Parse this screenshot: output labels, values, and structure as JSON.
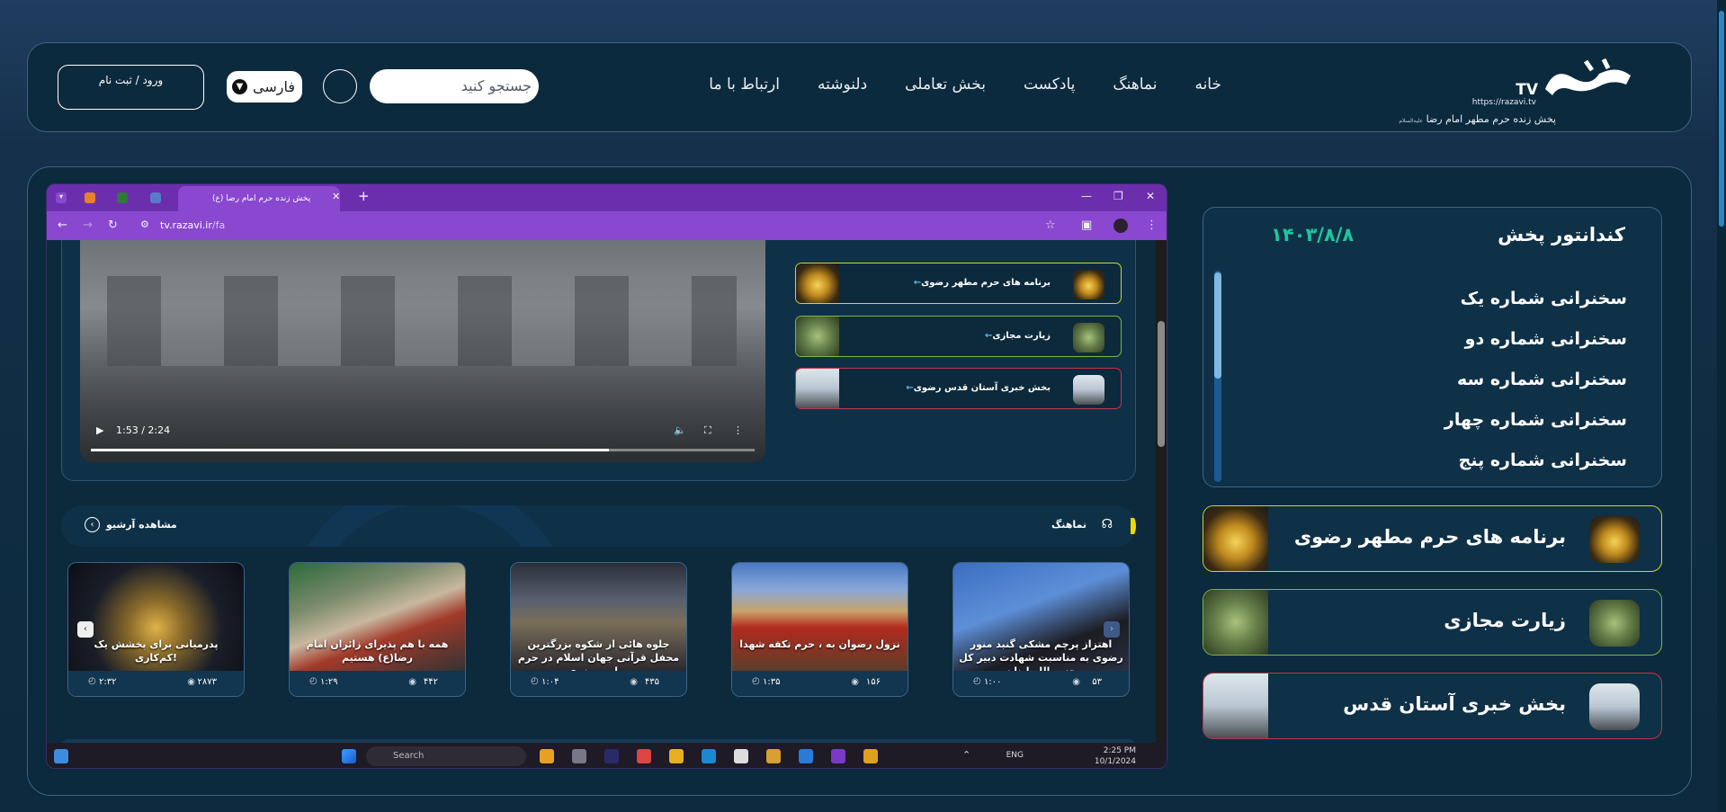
{
  "header": {
    "logo": {
      "tv": "TV",
      "url": "https://razavi.tv",
      "tagline": "پخش زنده حرم مطهر امام رضا",
      "tagline_small": "علیه‌السلام"
    },
    "nav": [
      "خانه",
      "نماهنگ",
      "پادکست",
      "بخش تعاملی",
      "دلنوشته",
      "ارتباط با ما"
    ],
    "search_placeholder": "جستجو کنید",
    "language": "فارسی",
    "login_label": "ورود / ثبت نام"
  },
  "schedule": {
    "title": "کندانتور پخش",
    "date": "۱۴۰۳/۸/۸",
    "items": [
      "سخنرانی شماره یک",
      "سخنرانی شماره دو",
      "سخنرانی شماره سه",
      "سخنرانی شماره چهار",
      "سخنرانی شماره پنج"
    ]
  },
  "channels": [
    {
      "label": "برنامه های حرم مطهر رضوی",
      "accent": "#c8d63a"
    },
    {
      "label": "زیارت مجازی",
      "accent": "#7ab83b"
    },
    {
      "label": "بخش خبری آستان قدس",
      "accent": "#c2354a"
    }
  ],
  "browser": {
    "tab_title": "پخش زنده حرم امام رضا (ع)",
    "url_host": "tv.razavi.ir",
    "url_path": "/fa",
    "video_time": "1:53 / 2:24",
    "video_progress": 0.78,
    "mini_channels": [
      {
        "label": "برنامه های حرم مطهر رضوی",
        "accent": "#c8d63a"
      },
      {
        "label": "زیارت مجازی",
        "accent": "#7ab83b"
      },
      {
        "label": "بخش خبری آستان قدس رضوی",
        "accent": "#c2354a"
      }
    ],
    "section": {
      "title": "نماهنگ",
      "archive": "مشاهده آرشیو"
    },
    "videos": [
      {
        "caption": "اهتزاز پرچم مشکی گنبد منور رضوی به مناسبت شهادت دبیر کل حزب الله لبنان",
        "views": "۵۳",
        "duration": "۱:۰۰"
      },
      {
        "caption": "نزول رضوان به ، حرم تکفه شهدا",
        "views": "۱۵۶",
        "duration": "۱:۳۵"
      },
      {
        "caption": "جلوه هائی از شکوه بزرگترین محفل قرآنی جهان اسلام در حرم مطهر رضوی",
        "views": "۴۳۵",
        "duration": "۱:۰۴"
      },
      {
        "caption": "همه با هم پذیرای زائران امام رضا(ع) هستیم",
        "views": "۴۴۲",
        "duration": "۱:۲۹"
      },
      {
        "caption": "پدرمیانی برای پخشش یک کم‌کاری!",
        "views": "۲۸۷۳",
        "duration": "۲:۳۲"
      }
    ],
    "taskbar": {
      "search": "Search",
      "lang": "ENG",
      "time": "2:25 PM",
      "date": "10/1/2024"
    }
  }
}
